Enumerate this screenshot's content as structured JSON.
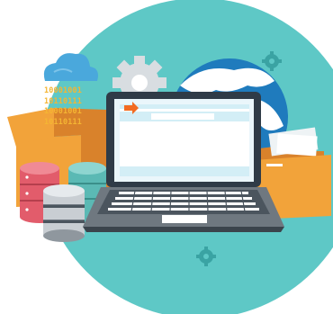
{
  "illustration": {
    "binary_lines": [
      "10001001",
      "10110111",
      "10001001",
      "10110111"
    ],
    "colors": {
      "teal_circle": "#5ec8c6",
      "dark_teal": "#3aa3a3",
      "globe_blue": "#1f7bbd",
      "box_orange": "#f2a33a",
      "box_dark_orange": "#d9822b",
      "binary_text": "#f4b533",
      "cloud": "#4aa8dc",
      "laptop_body": "#2f3b47",
      "laptop_base": "#6f7880",
      "screen_window": "#ffffff",
      "window_bar": "#d3eef6",
      "accent_arrow": "#f26b21",
      "db_red": "#e25c6b",
      "db_teal": "#5bb9b4",
      "db_gray": "#c9ced3",
      "gear_gray": "#d8dde1"
    },
    "icons": [
      "cloud-icon",
      "gear-icon",
      "globe-icon",
      "laptop-icon",
      "folder-icon",
      "box-icon",
      "database-icon",
      "arrow-icon"
    ]
  }
}
